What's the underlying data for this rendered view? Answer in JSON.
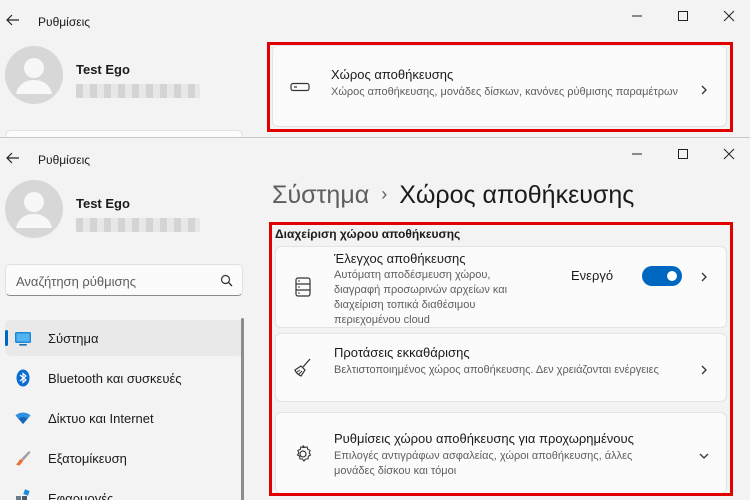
{
  "app": {
    "title": "Ρυθμίσεις"
  },
  "user": {
    "name": "Test Ego"
  },
  "top_window": {
    "storage_card": {
      "title": "Χώρος αποθήκευσης",
      "desc": "Χώρος αποθήκευσης, μονάδες δίσκων, κανόνες ρύθμισης παραμέτρων"
    }
  },
  "search": {
    "placeholder": "Αναζήτηση ρύθμισης"
  },
  "nav": {
    "items": [
      {
        "label": "Σύστημα",
        "icon": "system-monitor-icon",
        "selected": true
      },
      {
        "label": "Bluetooth και συσκευές",
        "icon": "bluetooth-icon"
      },
      {
        "label": "Δίκτυο και Internet",
        "icon": "wifi-icon"
      },
      {
        "label": "Εξατομίκευση",
        "icon": "paintbrush-icon"
      },
      {
        "label": "Εφαρμογές",
        "icon": "apps-icon"
      }
    ]
  },
  "breadcrumb": {
    "parent": "Σύστημα",
    "separator": "›",
    "current": "Χώρος αποθήκευσης"
  },
  "section": {
    "label": "Διαχείριση χώρου αποθήκευσης",
    "cards": [
      {
        "title": "Έλεγχος αποθήκευσης",
        "desc": "Αυτόματη αποδέσμευση χώρου, διαγραφή προσωρινών αρχείων και διαχείριση τοπικά διαθέσιμου περιεχομένου cloud",
        "icon": "storage-drive-icon",
        "toggle_label": "Ενεργό",
        "toggle_on": true
      },
      {
        "title": "Προτάσεις εκκαθάρισης",
        "desc": "Βελτιστοποιημένος χώρος αποθήκευσης. Δεν χρειάζονται ενέργειες",
        "icon": "broom-icon"
      },
      {
        "title": "Ρυθμίσεις χώρου αποθήκευσης για προχωρημένους",
        "desc": "Επιλογές αντιγράφων ασφαλείας, χώροι αποθήκευσης, άλλες μονάδες δίσκου και τόμοι",
        "icon": "gear-icon"
      }
    ]
  },
  "colors": {
    "accent": "#0067c0",
    "highlight_border": "#e00000"
  }
}
